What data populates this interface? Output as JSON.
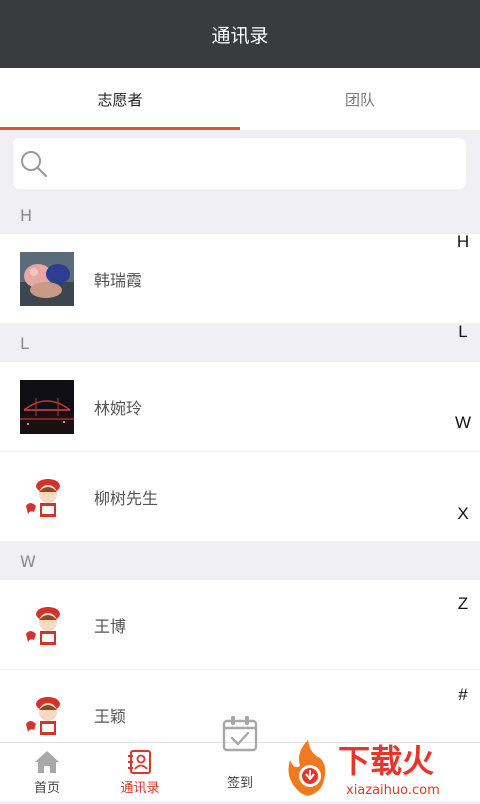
{
  "header": {
    "title": "通讯录"
  },
  "tabs": [
    {
      "label": "志愿者",
      "active": true
    },
    {
      "label": "团队",
      "active": false
    }
  ],
  "search": {
    "placeholder": "",
    "value": ""
  },
  "sections": [
    {
      "letter": "H",
      "contacts": [
        {
          "name": "韩瑞霞"
        }
      ]
    },
    {
      "letter": "L",
      "contacts": [
        {
          "name": "林婉玲"
        },
        {
          "name": "柳树先生"
        }
      ]
    },
    {
      "letter": "W",
      "contacts": [
        {
          "name": "王博"
        },
        {
          "name": "王颖"
        }
      ]
    }
  ],
  "index_letters": [
    "H",
    "L",
    "W",
    "X",
    "Z",
    "#"
  ],
  "bottom_nav": {
    "home": "首页",
    "contacts": "通讯录",
    "checkin": "签到"
  },
  "watermark": {
    "brand": "下载火",
    "url": "xiazaihuo.com"
  },
  "colors": {
    "accent": "#e0532f",
    "active_nav": "#d9372b",
    "titlebar": "#3a3b3d"
  }
}
